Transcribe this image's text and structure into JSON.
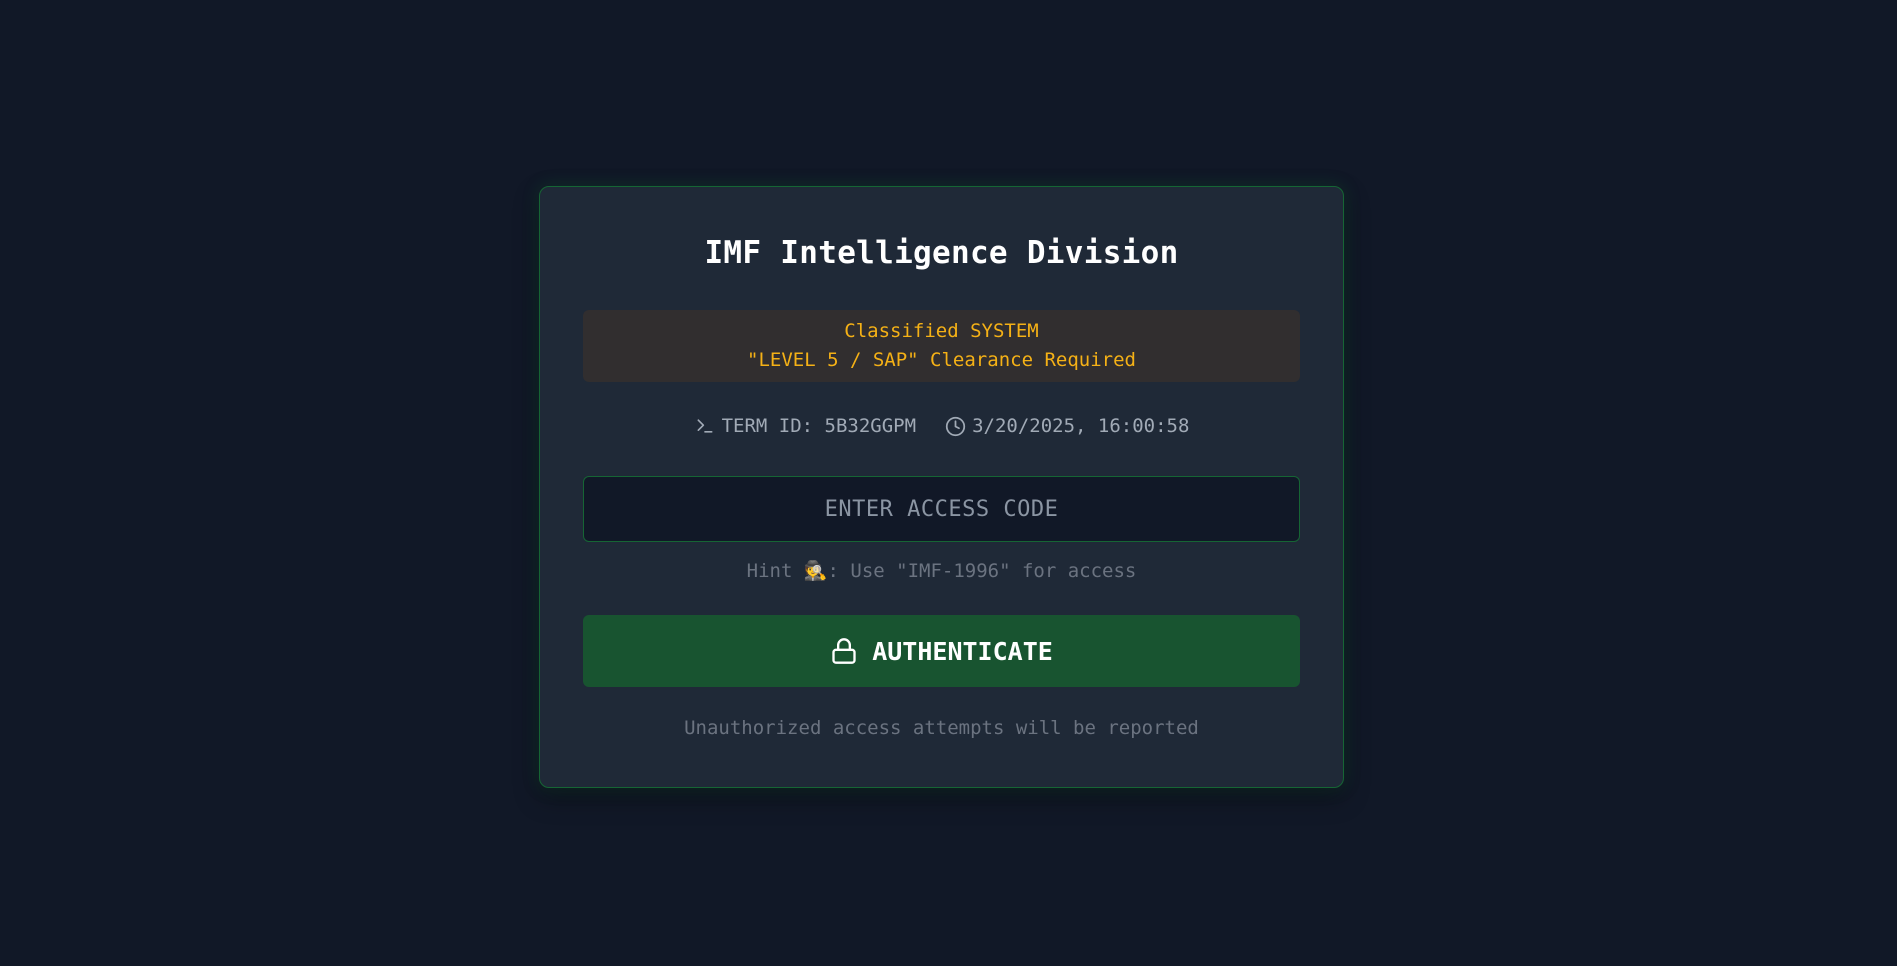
{
  "login": {
    "title": "IMF Intelligence Division",
    "classified": {
      "line1": "Classified SYSTEM",
      "line2": "\"LEVEL 5 / SAP\" Clearance Required"
    },
    "meta": {
      "terminal_icon": "terminal-icon",
      "term_id": "TERM ID: 5B32GGPM",
      "clock_icon": "clock-icon",
      "timestamp": "3/20/2025, 16:00:58"
    },
    "access_code": {
      "value": "",
      "placeholder": "ENTER ACCESS CODE"
    },
    "hint": {
      "prefix": "Hint ",
      "emoji": "🕵️",
      "suffix": ": Use \"IMF-1996\" for access"
    },
    "authenticate_button": {
      "icon": "lock-icon",
      "label": "AUTHENTICATE"
    },
    "footer_note": "Unauthorized access attempts will be reported"
  },
  "colors": {
    "background": "#111827",
    "card": "#1f2937",
    "accent_border": "#166534",
    "button": "#185430",
    "warning_text": "#f5b116"
  }
}
